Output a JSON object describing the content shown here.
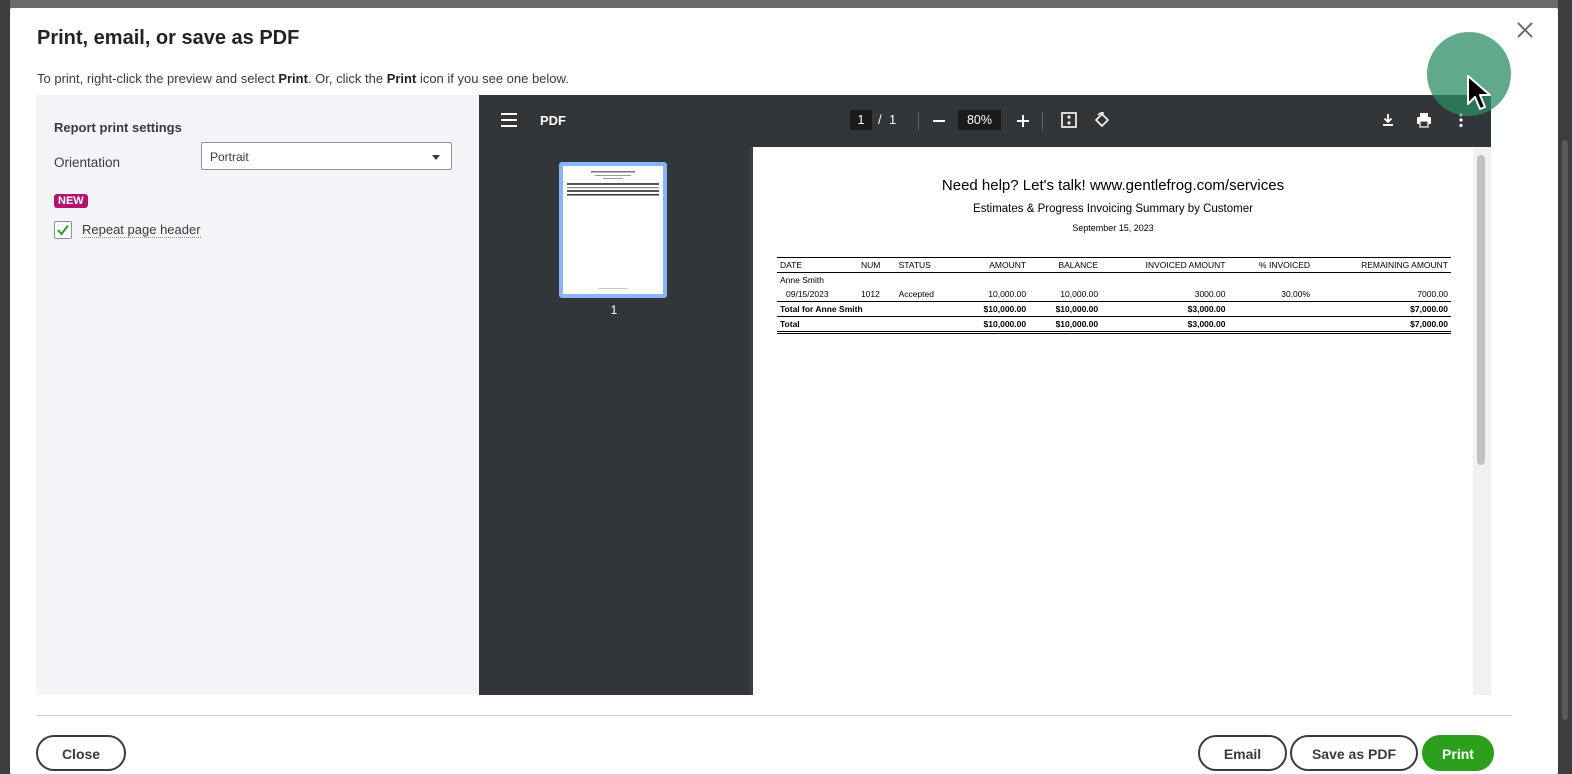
{
  "dialog": {
    "title": "Print, email, or save as PDF",
    "instructions_pre": "To print, right-click the preview and select ",
    "instructions_print1": "Print",
    "instructions_mid": ". Or, click the ",
    "instructions_print2": "Print",
    "instructions_post": " icon if you see one below."
  },
  "settings": {
    "title": "Report print settings",
    "orientation_label": "Orientation",
    "orientation_value": "Portrait",
    "new_badge": "NEW",
    "repeat_header_label": "Repeat page header",
    "repeat_header_checked": true
  },
  "viewer": {
    "title": "PDF",
    "current_page": "1",
    "page_separator": "/",
    "total_pages": "1",
    "zoom": "80%",
    "thumbnail_label": "1"
  },
  "report": {
    "headline": "Need help? Let's talk! www.gentlefrog.com/services",
    "subtitle": "Estimates & Progress Invoicing Summary by Customer",
    "date": "September 15, 2023",
    "columns": [
      "DATE",
      "NUM",
      "STATUS",
      "AMOUNT",
      "BALANCE",
      "INVOICED AMOUNT",
      "% INVOICED",
      "REMAINING AMOUNT"
    ],
    "customer": "Anne Smith",
    "row": [
      "09/15/2023",
      "1012",
      "Accepted",
      "10,000.00",
      "10,000.00",
      "3000.00",
      "30.00%",
      "7000.00"
    ],
    "subtotal": [
      "Total for Anne Smith",
      "$10,000.00",
      "$10,000.00",
      "$3,000.00",
      "$7,000.00"
    ],
    "total": [
      "Total",
      "$10,000.00",
      "$10,000.00",
      "$3,000.00",
      "$7,000.00"
    ]
  },
  "footer": {
    "close": "Close",
    "email": "Email",
    "save_pdf": "Save as PDF",
    "print": "Print"
  },
  "colors": {
    "primary_green": "#2ca01c",
    "badge_magenta": "#b3136e",
    "viewer_toolbar": "#323639"
  }
}
